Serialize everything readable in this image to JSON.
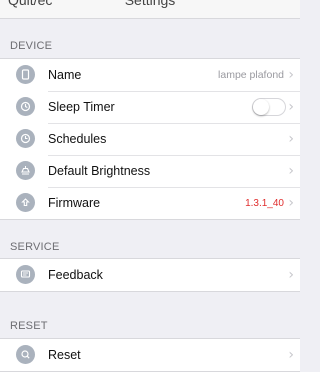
{
  "navbar": {
    "back_label": "Quit/ec",
    "title": "Settings"
  },
  "device": {
    "header": "DEVICE",
    "items": [
      {
        "label": "Name",
        "value": "lampe plafond",
        "icon": "device-icon"
      },
      {
        "label": "Sleep Timer",
        "toggle_on": false,
        "icon": "timer-icon"
      },
      {
        "label": "Schedules",
        "icon": "clock-icon"
      },
      {
        "label": "Default Brightness",
        "icon": "lamp-icon"
      },
      {
        "label": "Firmware",
        "value": "1.3.1_40",
        "icon": "firmware-icon"
      }
    ]
  },
  "service": {
    "header": "SERVICE",
    "items": [
      {
        "label": "Feedback",
        "icon": "feedback-icon"
      }
    ]
  },
  "reset": {
    "header": "RESET",
    "items": [
      {
        "label": "Reset",
        "icon": "reset-icon"
      }
    ]
  },
  "colors": {
    "background": "#efeff4",
    "icon": "#aab2bd",
    "firmware_value": "#e02d2d",
    "chevron": "#c7c7cc"
  }
}
